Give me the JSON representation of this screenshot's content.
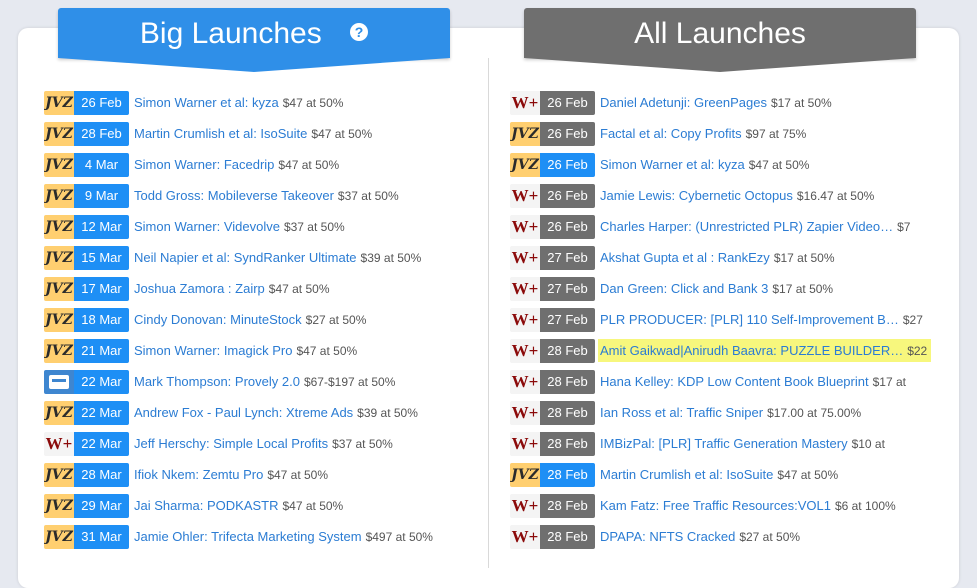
{
  "big_launches": {
    "title": "Big Launches",
    "help_icon": "?",
    "items": [
      {
        "platform": "JVZ",
        "logo_text": "JVZ",
        "date": "26 Feb",
        "title": "Simon Warner et al: kyza",
        "price": "$47 at 50%"
      },
      {
        "platform": "JVZ",
        "logo_text": "JVZ",
        "date": "28 Feb",
        "title": "Martin Crumlish et al: IsoSuite",
        "price": "$47 at 50%"
      },
      {
        "platform": "JVZ",
        "logo_text": "JVZ",
        "date": "4 Mar",
        "title": "Simon Warner: Facedrip",
        "price": "$47 at 50%"
      },
      {
        "platform": "JVZ",
        "logo_text": "JVZ",
        "date": "9 Mar",
        "title": "Todd Gross: Mobileverse Takeover",
        "price": "$37 at 50%"
      },
      {
        "platform": "JVZ",
        "logo_text": "JVZ",
        "date": "12 Mar",
        "title": "Simon Warner: Videvolve",
        "price": "$37 at 50%"
      },
      {
        "platform": "JVZ",
        "logo_text": "JVZ",
        "date": "15 Mar",
        "title": "Neil Napier et al: SyndRanker Ultimate",
        "price": "$39 at 50%"
      },
      {
        "platform": "JVZ",
        "logo_text": "JVZ",
        "date": "17 Mar",
        "title": "Joshua Zamora : Zairp",
        "price": "$47 at 50%"
      },
      {
        "platform": "JVZ",
        "logo_text": "JVZ",
        "date": "18 Mar",
        "title": "Cindy Donovan: MinuteStock",
        "price": "$27 at 50%"
      },
      {
        "platform": "JVZ",
        "logo_text": "JVZ",
        "date": "21 Mar",
        "title": "Simon Warner: Imagick Pro",
        "price": "$47 at 50%"
      },
      {
        "platform": "DOC",
        "logo_text": "",
        "date": "22 Mar",
        "title": "Mark Thompson: Provely 2.0",
        "price": "$67-$197 at 50%"
      },
      {
        "platform": "JVZ",
        "logo_text": "JVZ",
        "date": "22 Mar",
        "title": "Andrew Fox - Paul Lynch: Xtreme Ads",
        "price": "$39 at 50%"
      },
      {
        "platform": "W+",
        "logo_text": "W+",
        "date": "22 Mar",
        "title": "Jeff Herschy: Simple Local Profits",
        "price": "$37 at 50%"
      },
      {
        "platform": "JVZ",
        "logo_text": "JVZ",
        "date": "28 Mar",
        "title": "Ifiok Nkem: Zemtu Pro",
        "price": "$47 at 50%"
      },
      {
        "platform": "JVZ",
        "logo_text": "JVZ",
        "date": "29 Mar",
        "title": "Jai Sharma: PODKASTR",
        "price": "$47 at 50%"
      },
      {
        "platform": "JVZ",
        "logo_text": "JVZ",
        "date": "31 Mar",
        "title": "Jamie Ohler: Trifecta Marketing System",
        "price": "$497 at 50%"
      }
    ]
  },
  "all_launches": {
    "title": "All Launches",
    "items": [
      {
        "platform": "W+",
        "logo_text": "W+",
        "date": "26 Feb",
        "date_color": "gray",
        "title": "Daniel Adetunji: GreenPages",
        "price": "$17 at 50%"
      },
      {
        "platform": "JVZ",
        "logo_text": "JVZ",
        "date": "26 Feb",
        "date_color": "gray",
        "title": "Factal et al: Copy Profits",
        "price": "$97 at 75%"
      },
      {
        "platform": "JVZ",
        "logo_text": "JVZ",
        "date": "26 Feb",
        "date_color": "blue",
        "title": "Simon Warner et al: kyza",
        "price": "$47 at 50%"
      },
      {
        "platform": "W+",
        "logo_text": "W+",
        "date": "26 Feb",
        "date_color": "gray",
        "title": "Jamie Lewis: Cybernetic Octopus",
        "price": "$16.47 at 50%"
      },
      {
        "platform": "W+",
        "logo_text": "W+",
        "date": "26 Feb",
        "date_color": "gray",
        "title": "Charles Harper: (Unrestricted PLR) Zapier Video…",
        "price": "$7"
      },
      {
        "platform": "W+",
        "logo_text": "W+",
        "date": "27 Feb",
        "date_color": "gray",
        "title": "Akshat Gupta et al : RankEzy",
        "price": "$17 at 50%"
      },
      {
        "platform": "W+",
        "logo_text": "W+",
        "date": "27 Feb",
        "date_color": "gray",
        "title": "Dan Green: Click and Bank 3",
        "price": "$17 at 50%"
      },
      {
        "platform": "W+",
        "logo_text": "W+",
        "date": "27 Feb",
        "date_color": "gray",
        "title": "PLR PRODUCER: [PLR] 110 Self-Improvement B…",
        "price": "$27"
      },
      {
        "platform": "W+",
        "logo_text": "W+",
        "date": "28 Feb",
        "date_color": "gray",
        "title": "Amit Gaikwad|Anirudh Baavra: PUZZLE BUILDER…",
        "price": "$22",
        "highlight": true
      },
      {
        "platform": "W+",
        "logo_text": "W+",
        "date": "28 Feb",
        "date_color": "gray",
        "title": "Hana Kelley: KDP Low Content Book Blueprint",
        "price": "$17 at"
      },
      {
        "platform": "W+",
        "logo_text": "W+",
        "date": "28 Feb",
        "date_color": "gray",
        "title": "Ian Ross et al: Traffic Sniper",
        "price": "$17.00 at 75.00%"
      },
      {
        "platform": "W+",
        "logo_text": "W+",
        "date": "28 Feb",
        "date_color": "gray",
        "title": "IMBizPal: [PLR] Traffic Generation Mastery",
        "price": "$10 at"
      },
      {
        "platform": "JVZ",
        "logo_text": "JVZ",
        "date": "28 Feb",
        "date_color": "blue",
        "title": "Martin Crumlish et al: IsoSuite",
        "price": "$47 at 50%"
      },
      {
        "platform": "W+",
        "logo_text": "W+",
        "date": "28 Feb",
        "date_color": "gray",
        "title": "Kam Fatz: Free Traffic Resources:VOL1",
        "price": "$6 at 100%"
      },
      {
        "platform": "W+",
        "logo_text": "W+",
        "date": "28 Feb",
        "date_color": "gray",
        "title": "DPAPA: NFTS Cracked",
        "price": "$27 at 50%"
      }
    ]
  },
  "icons": {
    "jvz": "jvzoo-logo-icon",
    "wplus": "warriorplus-logo-icon",
    "doc": "document-icon",
    "help": "help-icon"
  },
  "colors": {
    "blue": "#2f8fe8",
    "gray": "#6f6f6f",
    "link": "#2b7cd3",
    "highlight": "#f7f77d"
  }
}
